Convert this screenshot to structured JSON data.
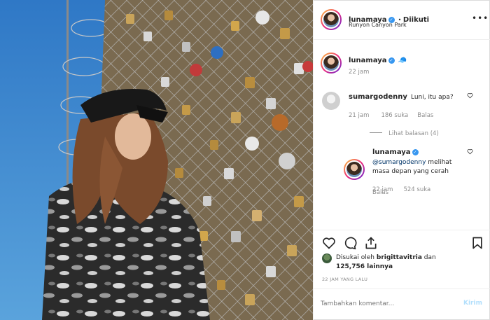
{
  "post": {
    "username": "lunamaya",
    "follow_status": "Diikuti",
    "location": "Runyon Canyon Park"
  },
  "caption": {
    "username": "lunamaya",
    "emoji": "🧢",
    "time": "22 jam"
  },
  "comments": [
    {
      "username": "sumargodenny",
      "text": "Luni, itu apa?",
      "time": "21 jam",
      "likes": "186 suka",
      "reply": "Balas",
      "view_replies": "Lihat balasan (4)"
    },
    {
      "username": "lunamaya",
      "mention": "@sumargodenny",
      "text": "melihat masa depan yang cerah",
      "time": "22 jam",
      "likes": "524 suka",
      "reply": "Balas"
    }
  ],
  "likes": {
    "liked_by_prefix": "Disukai oleh",
    "liked_by_user": "brigittavitria",
    "and": "dan",
    "others": "125,756 lainnya"
  },
  "timestamp": "22 JAM YANG LALU",
  "add_comment": {
    "placeholder": "Tambahkan komentar...",
    "submit": "Kirim"
  },
  "colors": {
    "link_blue": "#003569",
    "verified": "#3897f0",
    "submit_disabled": "#b2dffc"
  },
  "icons": [
    "heart-icon",
    "comment-icon",
    "share-icon",
    "bookmark-icon",
    "more-options-icon",
    "verified-icon"
  ]
}
